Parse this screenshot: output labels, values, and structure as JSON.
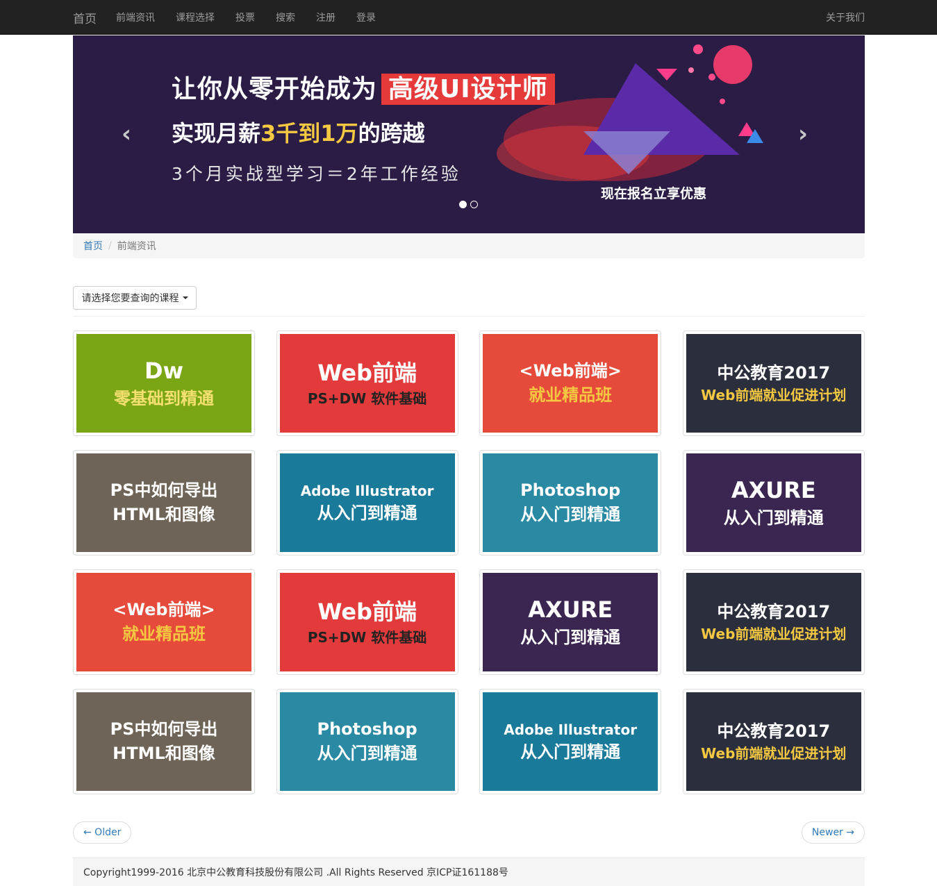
{
  "navbar": {
    "brand": "首页",
    "items": [
      "前端资讯",
      "课程选择",
      "投票",
      "搜索",
      "注册",
      "登录"
    ],
    "right": "关于我们"
  },
  "carousel": {
    "line1": "让你从零开始成为",
    "line1_highlight": "高级UI设计师",
    "line2_a": "实现月薪",
    "line2_b": "3千到1万",
    "line2_c": "的跨越",
    "line3": "3个月实战型学习＝2年工作经验",
    "cta": "现在报名立享优惠",
    "prev": "‹",
    "next": "›"
  },
  "breadcrumb": {
    "home": "首页",
    "separator": "/",
    "current": "前端资讯"
  },
  "dropdown": {
    "label": "请选择您要查询的课程"
  },
  "courses": [
    {
      "title": "Dw",
      "sub": "零基础到精通",
      "bg": "#7aa616",
      "subcolor": "#f5e070"
    },
    {
      "title": "Web前端",
      "sub": "PS+DW 软件基础",
      "bg": "#e33b3b",
      "subcolor": "#222222"
    },
    {
      "title": "<Web前端>",
      "sub": "就业精品班",
      "bg": "#e64a3b",
      "subcolor": "#f5c842"
    },
    {
      "title": "中公教育2017",
      "sub": "Web前端就业促进计划",
      "bg": "#2b2e3c",
      "subcolor": "#f5c842"
    },
    {
      "title": "PS中如何导出",
      "sub": "HTML和图像",
      "bg": "#6e6458",
      "subcolor": "#ffffff"
    },
    {
      "title": "Adobe Illustrator",
      "sub": "从入门到精通",
      "bg": "#1a7a9a",
      "subcolor": "#ffffff"
    },
    {
      "title": "Photoshop",
      "sub": "从入门到精通",
      "bg": "#2a8aa3",
      "subcolor": "#ffffff"
    },
    {
      "title": "AXURE",
      "sub": "从入门到精通",
      "bg": "#3a2650",
      "subcolor": "#ffffff"
    },
    {
      "title": "<Web前端>",
      "sub": "就业精品班",
      "bg": "#e64a3b",
      "subcolor": "#f5c842"
    },
    {
      "title": "Web前端",
      "sub": "PS+DW 软件基础",
      "bg": "#e33b3b",
      "subcolor": "#222222"
    },
    {
      "title": "AXURE",
      "sub": "从入门到精通",
      "bg": "#3a2650",
      "subcolor": "#ffffff"
    },
    {
      "title": "中公教育2017",
      "sub": "Web前端就业促进计划",
      "bg": "#2b2e3c",
      "subcolor": "#f5c842"
    },
    {
      "title": "PS中如何导出",
      "sub": "HTML和图像",
      "bg": "#6e6458",
      "subcolor": "#ffffff"
    },
    {
      "title": "Photoshop",
      "sub": "从入门到精通",
      "bg": "#2a8aa3",
      "subcolor": "#ffffff"
    },
    {
      "title": "Adobe Illustrator",
      "sub": "从入门到精通",
      "bg": "#1a7a9a",
      "subcolor": "#ffffff"
    },
    {
      "title": "中公教育2017",
      "sub": "Web前端就业促进计划",
      "bg": "#2b2e3c",
      "subcolor": "#f5c842"
    }
  ],
  "pager": {
    "older": "← Older",
    "newer": "Newer →"
  },
  "footer": {
    "text": "Copyright1999-2016 北京中公教育科技股份有限公司 .All Rights Reserved 京ICP证161188号"
  }
}
